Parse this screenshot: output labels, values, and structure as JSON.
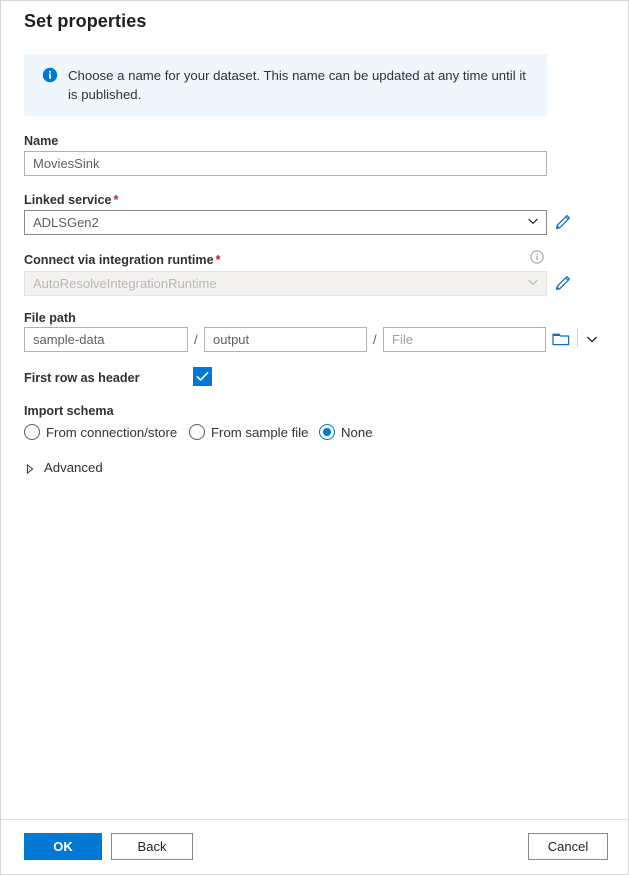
{
  "dialog": {
    "title": "Set properties"
  },
  "banner": {
    "icon": "info-filled-icon",
    "text": "Choose a name for your dataset. This name can be updated at any time until it is published."
  },
  "fields": {
    "name": {
      "label": "Name",
      "value": "MoviesSink",
      "placeholder": "Name"
    },
    "linked_service": {
      "label": "Linked service",
      "required_mark": "*",
      "value": "ADLSGen2",
      "edit_icon": "pencil-icon",
      "chevron_icon": "chevron-down-icon"
    },
    "integration_runtime": {
      "label": "Connect via integration runtime",
      "required_mark": "*",
      "value": "AutoResolveIntegrationRuntime",
      "info_icon": "info-outline-icon",
      "edit_icon": "pencil-icon",
      "chevron_icon": "chevron-down-icon",
      "disabled": true
    },
    "file_path": {
      "label": "File path",
      "container_value": "sample-data",
      "container_placeholder": "Container",
      "directory_value": "output",
      "directory_placeholder": "Directory",
      "file_value": "",
      "file_placeholder": "File",
      "separator": "/",
      "browse_icon": "folder-icon",
      "caret_icon": "chevron-down-icon"
    },
    "first_row_as_header": {
      "label": "First row as header",
      "checked": true,
      "check_icon": "checkmark-icon"
    },
    "import_schema": {
      "label": "Import schema",
      "options": [
        {
          "label": "From connection/store",
          "checked": false
        },
        {
          "label": "From sample file",
          "checked": false
        },
        {
          "label": "None",
          "checked": true
        }
      ]
    },
    "advanced": {
      "label": "Advanced",
      "expanded": false,
      "icon": "triangle-right-icon"
    }
  },
  "footer": {
    "ok_label": "OK",
    "back_label": "Back",
    "cancel_label": "Cancel"
  },
  "colors": {
    "accent": "#0078d4",
    "banner_bg": "#eff6fc",
    "required": "#a4262c",
    "text": "#323130"
  }
}
